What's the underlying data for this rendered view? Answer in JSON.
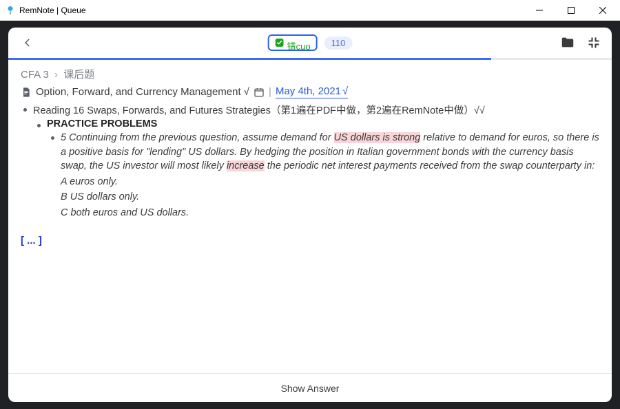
{
  "window": {
    "title": "RemNote | Queue"
  },
  "toolbar": {
    "tag_label": "错cuo",
    "count": "110",
    "progress_percent": 80
  },
  "breadcrumb": {
    "root": "CFA 3",
    "leaf": "课后题"
  },
  "doc": {
    "title": "Option, Forward, and Currency Management √",
    "date": "May 4th, 2021",
    "date_suffix": "√"
  },
  "reading": "Reading 16 Swaps, Forwards, and Futures Strategies（第1遍在PDF中做，第2遍在RemNote中做）√√",
  "section": "PRACTICE PROBLEMS",
  "question": {
    "num": "5",
    "pre1": "Continuing from the previous question, assume demand for ",
    "hl1": "US dollars is strong",
    "mid1": " relative to demand for euros, so there is a positive basis for \"lending\" US dollars. By hedging the position in Italian government bonds with the currency basis swap, the US investor will most likely ",
    "hl2": "increase",
    "post1": " the periodic net interest payments received from the swap counterparty in:",
    "choice_a": "A euros only.",
    "choice_b": "B US dollars only.",
    "choice_c": "C both euros and US dollars."
  },
  "cloze": "[ ... ]",
  "footer": {
    "show_answer": "Show Answer"
  }
}
